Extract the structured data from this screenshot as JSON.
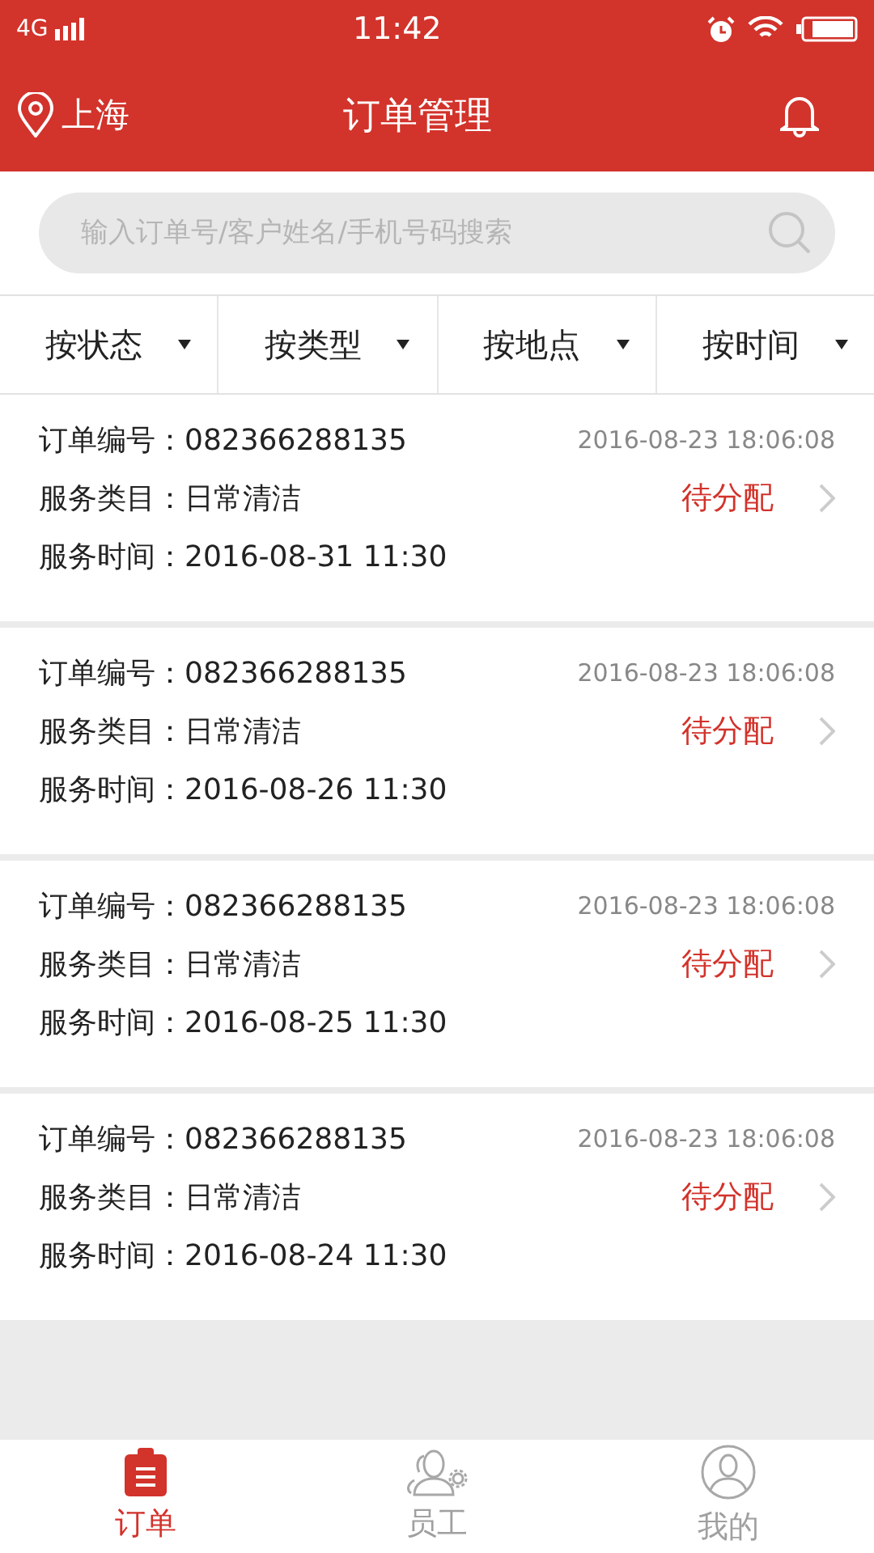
{
  "status_bar": {
    "network": "4G",
    "time": "11:42"
  },
  "header": {
    "location": "上海",
    "title": "订单管理"
  },
  "search": {
    "placeholder": "输入订单号/客户姓名/手机号码搜索"
  },
  "filters": [
    {
      "label": "按状态"
    },
    {
      "label": "按类型"
    },
    {
      "label": "按地点"
    },
    {
      "label": "按时间"
    }
  ],
  "orders": [
    {
      "order_no": "订单编号：082366288135",
      "created": "2016-08-23 18:06:08",
      "category": "服务类目：日常清洁",
      "status": "待分配",
      "service_time": "服务时间：2016-08-31  11:30"
    },
    {
      "order_no": "订单编号：082366288135",
      "created": "2016-08-23 18:06:08",
      "category": "服务类目：日常清洁",
      "status": "待分配",
      "service_time": "服务时间：2016-08-26  11:30"
    },
    {
      "order_no": "订单编号：082366288135",
      "created": "2016-08-23 18:06:08",
      "category": "服务类目：日常清洁",
      "status": "待分配",
      "service_time": "服务时间：2016-08-25  11:30"
    },
    {
      "order_no": "订单编号：082366288135",
      "created": "2016-08-23 18:06:08",
      "category": "服务类目：日常清洁",
      "status": "待分配",
      "service_time": "服务时间：2016-08-24  11:30"
    }
  ],
  "tab_bar": [
    {
      "kind": "orders",
      "label": "订单",
      "selected": true
    },
    {
      "kind": "staff",
      "label": "员工",
      "selected": false
    },
    {
      "kind": "profile",
      "label": "我的",
      "selected": false
    }
  ]
}
